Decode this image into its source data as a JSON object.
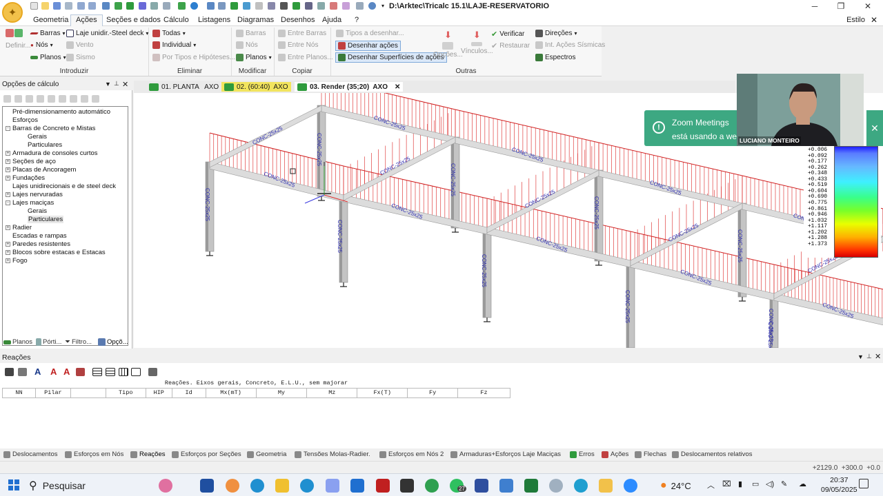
{
  "window": {
    "title": "D:\\Arktec\\Tricalc 15.1\\LAJE-RESERVATORIO",
    "app_icon": "tricalc-logo-icon",
    "controls": [
      "minimize-icon",
      "restore-icon",
      "close-icon"
    ]
  },
  "menu": {
    "items": [
      "Geometria",
      "Ações",
      "Seções e dados",
      "Cálculo",
      "Listagens",
      "Diagramas",
      "Desenhos",
      "Ajuda",
      "?"
    ],
    "active": "Ações",
    "style": "Estilo"
  },
  "ribbon": {
    "introduzir": {
      "label": "Introduzir",
      "definir": "Definir...",
      "barras": "Barras",
      "nos": "Nós",
      "planos": "Planos",
      "laje": "Laje unidir.-Steel deck",
      "vento": "Vento",
      "sismo": "Sismo"
    },
    "eliminar": {
      "label": "Eliminar",
      "todas": "Todas",
      "individual": "Individual",
      "tipos": "Por Tipos e Hipóteses..."
    },
    "modificar": {
      "label": "Modificar",
      "barras": "Barras",
      "nos": "Nós",
      "planos": "Planos"
    },
    "copiar": {
      "label": "Copiar",
      "entre_barras": "Entre Barras",
      "entre_nos": "Entre Nós",
      "entre_planos": "Entre Planos..."
    },
    "outras": {
      "label": "Outras",
      "tipos": "Tipos a desenhar...",
      "desenhar_acoes": "Desenhar ações",
      "desenhar_sup": "Desenhar Superfícies de ações",
      "opcoes": "Opções...",
      "vinculos": "Vínculos...",
      "verificar": "Verificar",
      "restaurar": "Restaurar",
      "direcoes": "Direções",
      "int_acoes": "Int. Ações Sísmicas",
      "espectros": "Espectros"
    }
  },
  "left_panel": {
    "title": "Opções de cálculo",
    "tree": [
      {
        "label": "Pré-dimensionamento automático",
        "level": 0,
        "expander": false
      },
      {
        "label": "Esforços",
        "level": 0,
        "expander": false
      },
      {
        "label": "Barras de Concreto e Mistas",
        "level": 0,
        "expander": true,
        "state": "-"
      },
      {
        "label": "Gerais",
        "level": 1,
        "expander": false
      },
      {
        "label": "Particulares",
        "level": 1,
        "expander": false
      },
      {
        "label": "Armadura de consoles curtos",
        "level": 0,
        "expander": true,
        "state": "+"
      },
      {
        "label": "Seções de aço",
        "level": 0,
        "expander": true,
        "state": "+"
      },
      {
        "label": "Placas de Ancoragem",
        "level": 0,
        "expander": true,
        "state": "+"
      },
      {
        "label": "Fundações",
        "level": 0,
        "expander": true,
        "state": "+"
      },
      {
        "label": "Lajes unidirecionais e de steel deck",
        "level": 0,
        "expander": false
      },
      {
        "label": "Lajes nervuradas",
        "level": 0,
        "expander": true,
        "state": "+"
      },
      {
        "label": "Lajes maciças",
        "level": 0,
        "expander": true,
        "state": "-"
      },
      {
        "label": "Gerais",
        "level": 1,
        "expander": false
      },
      {
        "label": "Particulares",
        "level": 1,
        "expander": false,
        "selected": true
      },
      {
        "label": "Radier",
        "level": 0,
        "expander": true,
        "state": "+"
      },
      {
        "label": "Escadas e rampas",
        "level": 0,
        "expander": false
      },
      {
        "label": "Paredes resistentes",
        "level": 0,
        "expander": true,
        "state": "+"
      },
      {
        "label": "Blocos sobre estacas e Estacas",
        "level": 0,
        "expander": true,
        "state": "+"
      },
      {
        "label": "Fogo",
        "level": 0,
        "expander": true,
        "state": "+"
      }
    ],
    "tabs": [
      "Planos",
      "Pórti...",
      "Filtro...",
      "Opçõ..."
    ]
  },
  "doc_tabs": [
    {
      "label": "01. PLANTA   AXO",
      "active": false
    },
    {
      "label": "02. (60:40)  AXO",
      "active": false,
      "highlight": true
    },
    {
      "label": "03. Render (35;20)  AXO",
      "active": true
    }
  ],
  "viewport": {
    "section_label": "CONC-25x25"
  },
  "zoom": {
    "toast_line1": "Zoom Meetings",
    "toast_line2": "está usando a wel",
    "participant": "LUCIANO MONTEIRO"
  },
  "legend": {
    "values": [
      "+0.006",
      "+0.092",
      "+0.177",
      "+0.262",
      "+0.348",
      "+0.433",
      "+0.519",
      "+0.604",
      "+0.690",
      "+0.775",
      "+0.861",
      "+0.946",
      "+1.032",
      "+1.117",
      "+1.202",
      "+1.288",
      "+1.373"
    ]
  },
  "reacoes": {
    "title": "Reações",
    "table_title": "Reações. Eixos gerais, Concreto, E.L.U., sem majorar",
    "columns": [
      "NN",
      "Pilar",
      "",
      "Tipo",
      "HIP",
      "Id",
      "Mx(mT)",
      "My",
      "Mz",
      "Fx(T)",
      "Fy",
      "Fz"
    ]
  },
  "bottom_tabs": [
    "Deslocamentos",
    "Esforços em Nós",
    "Reações",
    "Esforços por Seções",
    "Geometria",
    "Tensões Molas-Radier.",
    "Esforços em Nós 2",
    "Armaduras+Esforços Laje Maciças",
    "Erros",
    "Ações",
    "Flechas",
    "Deslocamentos relativos"
  ],
  "bottom_active": "Reações",
  "status": {
    "coords": "+2129.0  +300.0  +0.0"
  },
  "taskbar": {
    "search": "Pesquisar",
    "temp": "24°C",
    "time": "20:37",
    "date": "09/05/2025",
    "badge": "27"
  }
}
